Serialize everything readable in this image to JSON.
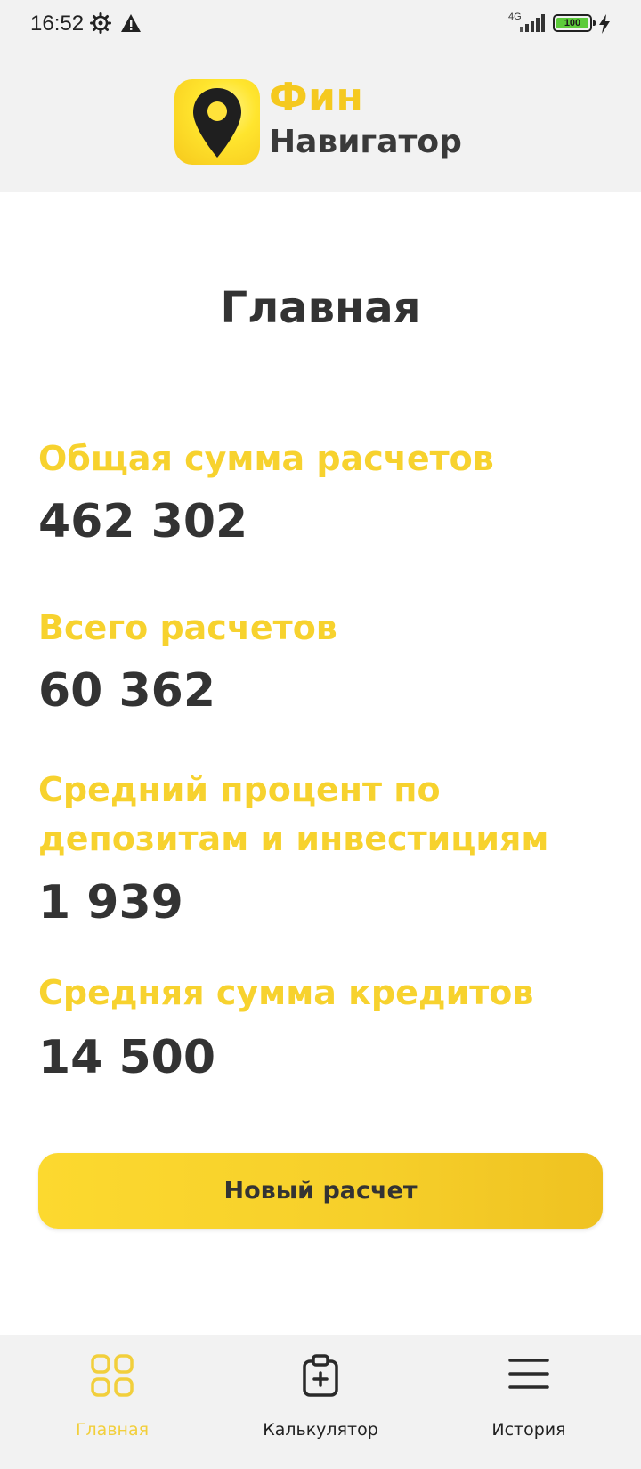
{
  "status_bar": {
    "time": "16:52",
    "network": "4G",
    "battery": "100",
    "icons": [
      "gear-icon",
      "warning-icon",
      "signal-icon",
      "battery-icon",
      "charging-icon"
    ]
  },
  "header": {
    "logo_line1": "Фин",
    "logo_line2": "Навигатор",
    "logo_icon": "location-pin-icon"
  },
  "main": {
    "title": "Главная",
    "stats": [
      {
        "label": "Общая сумма расчетов",
        "value": "462 302"
      },
      {
        "label": "Всего расчетов",
        "value": "60 362"
      },
      {
        "label": "Средний процент по депозитам и инвестициям",
        "value": "1 939"
      },
      {
        "label": "Средняя сумма кредитов",
        "value": "14 500"
      }
    ],
    "new_calc_label": "Новый расчет"
  },
  "bottom_nav": {
    "items": [
      {
        "label": "Главная",
        "icon": "grid-icon",
        "active": true
      },
      {
        "label": "Калькулятор",
        "icon": "clipboard-plus-icon",
        "active": false
      },
      {
        "label": "История",
        "icon": "menu-icon",
        "active": false
      }
    ]
  },
  "colors": {
    "accent_yellow": "#f7d22e",
    "text_dark": "#333333",
    "bar_gray": "#f2f2f2"
  }
}
